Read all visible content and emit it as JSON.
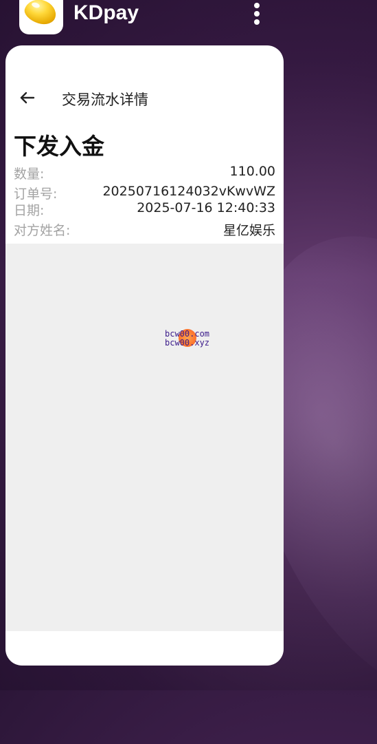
{
  "app": {
    "name": "KDpay"
  },
  "page": {
    "title": "交易流水详情",
    "heading": "下发入金"
  },
  "details": [
    {
      "label": "数量:",
      "value": "110.00"
    },
    {
      "label": "订单号:",
      "value": "20250716124032vKwvWZ"
    },
    {
      "label": "日期:",
      "value": "2025-07-16 12:40:33"
    },
    {
      "label": "对方姓名:",
      "value": "星亿娱乐"
    }
  ],
  "watermark": {
    "line1": "bcw00.com",
    "line2": "bcw00.xyz"
  },
  "colors": {
    "label_gray": "#a3a3a3",
    "panel_gray": "#efefef",
    "background_purple": "#3d1f4a"
  },
  "icons": {
    "back": "back-arrow-icon",
    "menu": "more-vert-icon",
    "app": "golden-bean-app-icon"
  }
}
